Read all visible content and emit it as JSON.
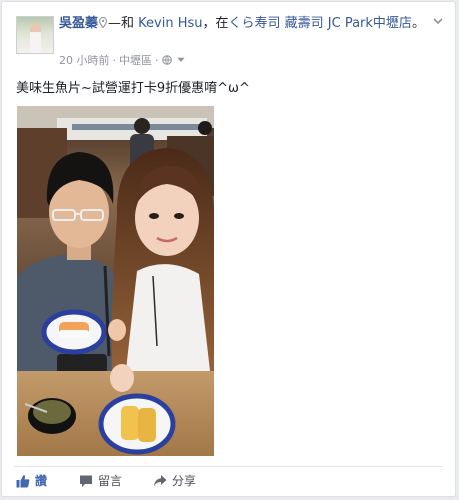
{
  "post": {
    "author": "吳盈蓁",
    "with_prefix": "—和",
    "tagged_friend": "Kevin Hsu",
    "at_prefix": "，在",
    "place": "くら寿司 藏壽司 JC Park中壢店",
    "place_end": "。",
    "time": "20 小時前",
    "location": "中壢區",
    "privacy_icon": "globe-icon",
    "message": "美味生魚片~試營運打卡9折優惠唷^ω^"
  },
  "actions": {
    "like": "讚",
    "comment": "留言",
    "share": "分享"
  },
  "colors": {
    "link": "#365899",
    "like_active": "#4267b2",
    "meta": "#90949c"
  }
}
